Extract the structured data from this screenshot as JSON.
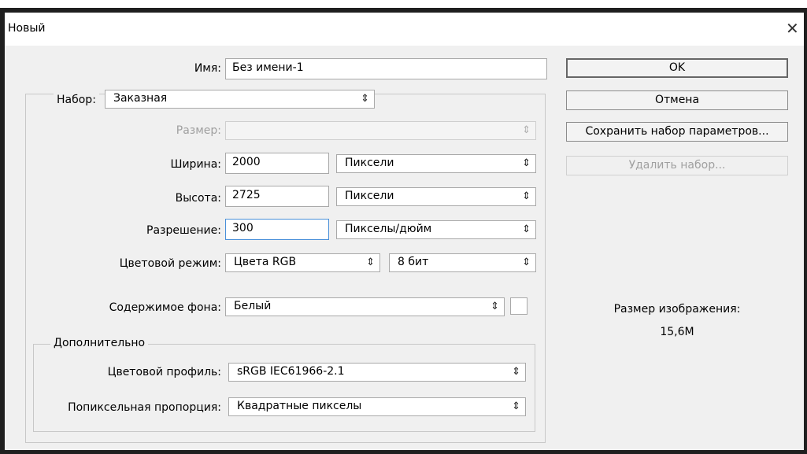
{
  "window": {
    "title": "Новый"
  },
  "form": {
    "name_label": "Имя:",
    "name_value": "Без имени-1",
    "preset_label": "Набор:",
    "preset_value": "Заказная",
    "size_label": "Размер:",
    "size_value": "",
    "width_label": "Ширина:",
    "width_value": "2000",
    "width_unit": "Пиксели",
    "height_label": "Высота:",
    "height_value": "2725",
    "height_unit": "Пиксели",
    "resolution_label": "Разрешение:",
    "resolution_value": "300",
    "resolution_unit": "Пикселы/дюйм",
    "color_mode_label": "Цветовой режим:",
    "color_mode_value": "Цвета RGB",
    "bit_depth_value": "8 бит",
    "background_label": "Содержимое фона:",
    "background_value": "Белый",
    "background_color": "#ffffff"
  },
  "advanced": {
    "title": "Дополнительно",
    "profile_label": "Цветовой профиль:",
    "profile_value": "sRGB IEC61966-2.1",
    "aspect_label": "Попиксельная пропорция:",
    "aspect_value": "Квадратные пикселы"
  },
  "buttons": {
    "ok": "OK",
    "cancel": "Отмена",
    "save_preset": "Сохранить набор параметров...",
    "delete_preset": "Удалить набор..."
  },
  "image_size": {
    "label": "Размер изображения:",
    "value": "15,6M"
  },
  "icons": {
    "close": "close-icon",
    "select_arrows": "updown-arrows-icon"
  }
}
